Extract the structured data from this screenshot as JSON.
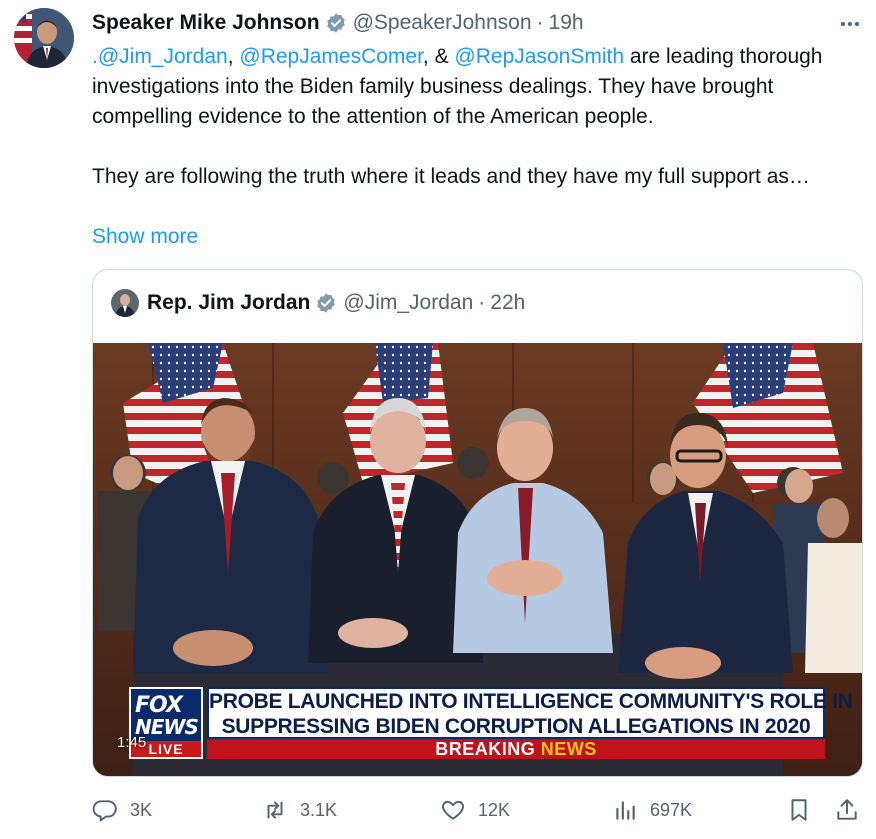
{
  "tweet": {
    "author_name": "Speaker Mike Johnson",
    "author_handle": "@SpeakerJohnson",
    "separator": "·",
    "time": "19h",
    "body": {
      "mention1": ".@Jim_Jordan",
      "sep1": ", ",
      "mention2": "@RepJamesComer",
      "sep2": ", & ",
      "mention3": "@RepJasonSmith",
      "text1": " are leading thorough investigations into the Biden family business dealings. They have brought compelling evidence to the attention of the American people.",
      "text2": "They are following the truth where it leads and they have my full support as…"
    },
    "show_more": "Show more"
  },
  "quote": {
    "author_name": "Rep. Jim Jordan",
    "author_handle": "@Jim_Jordan",
    "separator": "·",
    "time": "22h",
    "video": {
      "logo_top": "FOX",
      "logo_mid": "NEWS",
      "logo_live": "LIVE",
      "headline_line1": "PROBE LAUNCHED INTO INTELLIGENCE COMMUNITY'S ROLE IN",
      "headline_line2": "SUPPRESSING BIDEN CORRUPTION ALLEGATIONS IN 2020",
      "breaking_word": "BREAKING",
      "news_word": "NEWS",
      "timestamp": "1:45"
    }
  },
  "actions": {
    "replies": "3K",
    "reposts": "3.1K",
    "likes": "12K",
    "views": "697K"
  },
  "icons": {
    "verified": "verified-badge-icon",
    "more": "more-dots-icon",
    "reply": "reply-icon",
    "repost": "repost-icon",
    "like": "heart-icon",
    "views": "views-icon",
    "bookmark": "bookmark-icon",
    "share": "share-icon"
  },
  "colors": {
    "link": "#1d9bf0",
    "secondary_text": "#536471",
    "border": "#cfd9de",
    "chyron_red": "#c0121b",
    "chyron_blue": "#0b2a6b"
  }
}
